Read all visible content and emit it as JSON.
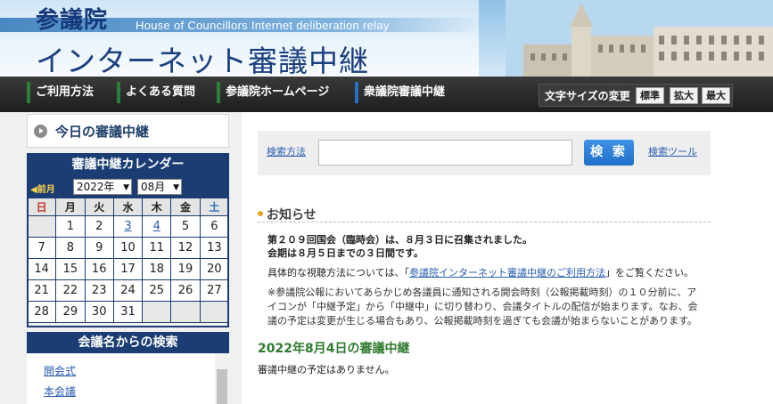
{
  "header": {
    "logo": "参議院",
    "subtitle": "House of Councillors Internet deliberation relay",
    "title": "インターネット審議中継"
  },
  "nav": {
    "items": [
      "ご利用方法",
      "よくある質問",
      "参議院ホームページ",
      "衆議院審議中継"
    ],
    "font_size": {
      "label": "文字サイズの変更",
      "standard": "標準",
      "large": "拡大",
      "max": "最大"
    }
  },
  "sidebar": {
    "today": "今日の審議中継",
    "calendar": {
      "title": "審議中継カレンダー",
      "prev": "◀前月",
      "year": "2022年",
      "month": "08月",
      "weekdays": [
        "日",
        "月",
        "火",
        "水",
        "木",
        "金",
        "土"
      ],
      "weeks": [
        [
          "",
          "1",
          "2",
          "3",
          "4",
          "5",
          "6"
        ],
        [
          "7",
          "8",
          "9",
          "10",
          "11",
          "12",
          "13"
        ],
        [
          "14",
          "15",
          "16",
          "17",
          "18",
          "19",
          "20"
        ],
        [
          "21",
          "22",
          "23",
          "24",
          "25",
          "26",
          "27"
        ],
        [
          "28",
          "29",
          "30",
          "31",
          "",
          "",
          ""
        ]
      ],
      "linked_days": [
        "3",
        "4"
      ]
    },
    "search": {
      "title": "会議名からの検索",
      "items": [
        "開会式",
        "本会議"
      ]
    }
  },
  "main": {
    "search": {
      "method": "検索方法",
      "placeholder": "",
      "button": "検 索",
      "tool": "検索ツール"
    },
    "notice": {
      "title": "お知らせ",
      "line1": "第２０９回国会（臨時会）は、８月３日に召集されました。",
      "line2": "会期は８月５日までの３日間です。",
      "line3_prefix": "具体的な視聴方法については、「",
      "line3_link": "参議院インターネット審議中継のご利用方法",
      "line3_suffix": "」をご覧ください。",
      "note1": "※参議院公報においてあらかじめ各議員に通知される開会時刻（公報掲載時刻）の１０分前に、ア",
      "note2": "イコンが「中継予定」から「中継中」に切り替わり、会議タイトルの配信が始まります。なお、会",
      "note3": "議の予定は変更が生じる場合もあり、公報掲載時刻を過ぎても会議が始まらないことがあります。"
    },
    "today": {
      "title": "2022年8月4日の審議中継",
      "message": "審議中継の予定はありません。"
    }
  }
}
